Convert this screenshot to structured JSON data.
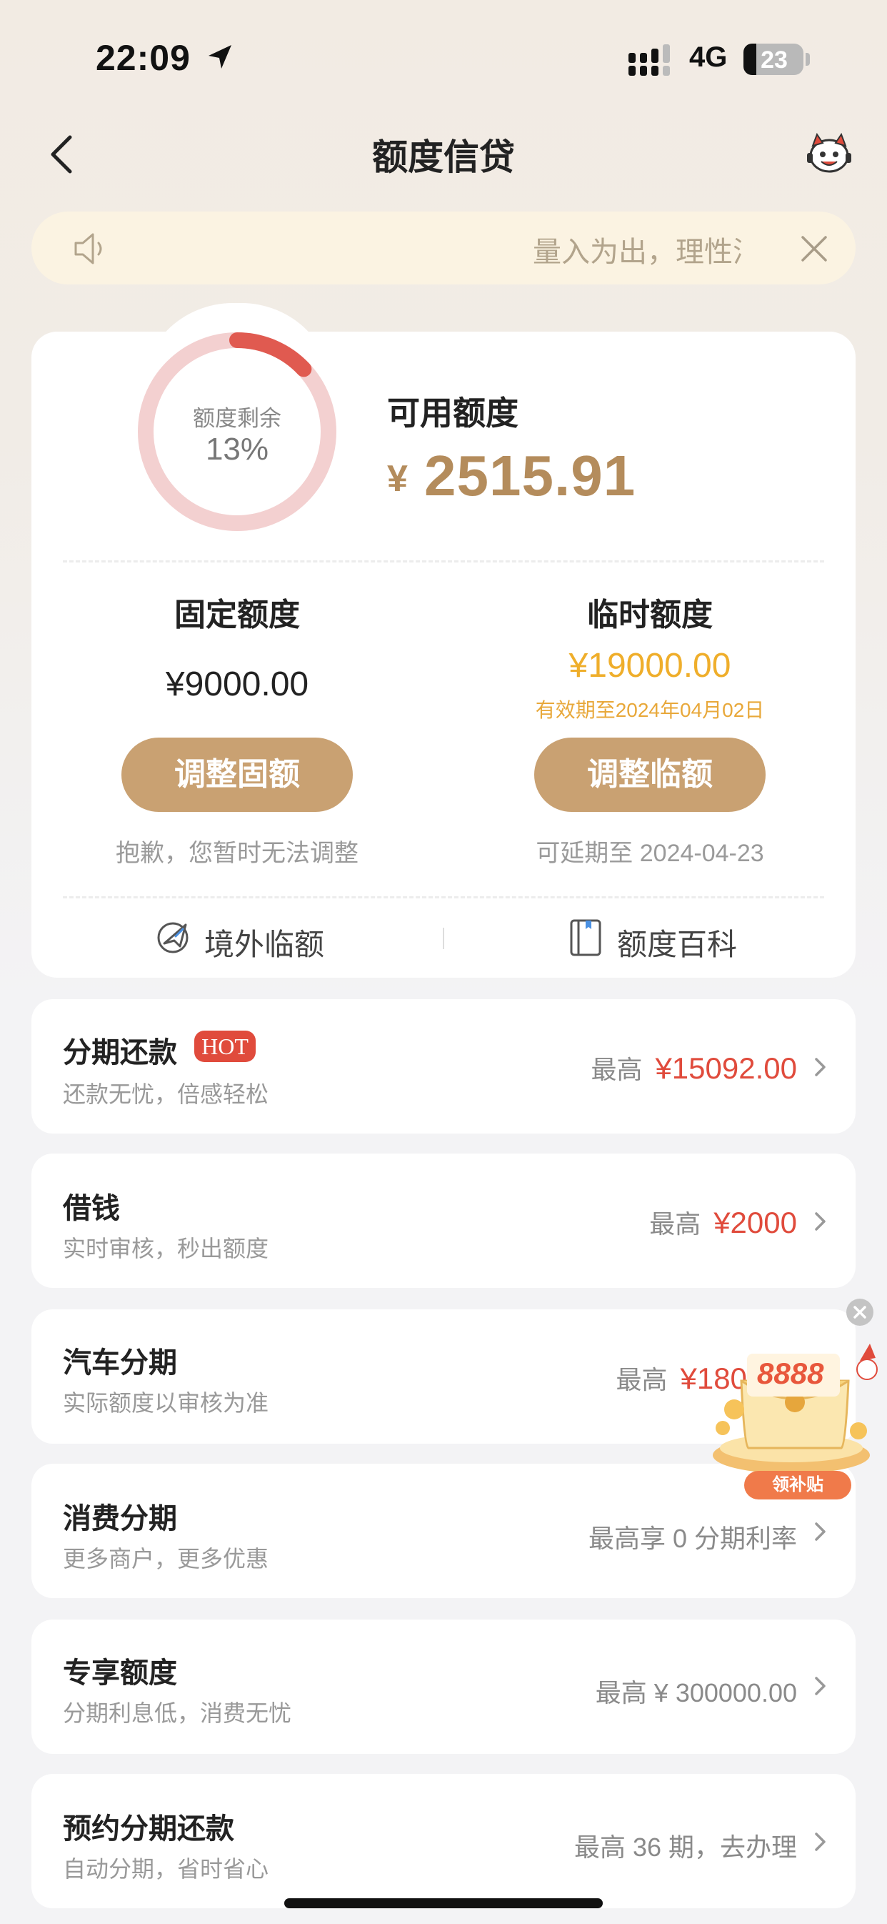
{
  "status_bar": {
    "time": "22:09",
    "network": "4G",
    "battery": "23"
  },
  "nav": {
    "title": "额度信贷"
  },
  "notice": {
    "text": "量入为出，理性消费"
  },
  "quota": {
    "ring_label": "额度剩余",
    "ring_percent": "13%",
    "ring_fraction": 0.13,
    "available_label": "可用额度",
    "currency": "¥",
    "available_amount": "2515.91",
    "fixed": {
      "title": "固定额度",
      "amount": "¥9000.00",
      "button": "调整固额",
      "note": "抱歉，您暂时无法调整"
    },
    "temporary": {
      "title": "临时额度",
      "amount": "¥19000.00",
      "validity": "有效期至2024年04月02日",
      "button": "调整临额",
      "note": "可延期至 2024-04-23"
    },
    "links": {
      "overseas": "境外临额",
      "wiki": "额度百科"
    }
  },
  "services": [
    {
      "title": "分期还款",
      "badge": "HOT",
      "subtitle": "还款无忧，倍感轻松",
      "prefix": "最高",
      "value": "¥15092.00"
    },
    {
      "title": "借钱",
      "subtitle": "实时审核，秒出额度",
      "prefix": "最高",
      "value": "¥2000"
    },
    {
      "title": "汽车分期",
      "subtitle": "实际额度以审核为准",
      "prefix": "最高",
      "value": "¥180000"
    },
    {
      "title": "消费分期",
      "subtitle": "更多商户，更多优惠",
      "text": "最高享 0 分期利率"
    },
    {
      "title": "专享额度",
      "subtitle": "分期利息低，消费无忧",
      "text": "最高 ¥ 300000.00"
    },
    {
      "title": "预约分期还款",
      "subtitle": "自动分期，省时省心",
      "text": "最高 36 期，去办理"
    }
  ],
  "promo": {
    "amount": "8888",
    "label": "领补贴"
  },
  "colors": {
    "accent": "#c9a172",
    "gold_text": "#b48c5c",
    "red": "#e04b3c",
    "ring_track": "#f3d0d0",
    "ring_fill": "#e05a50"
  }
}
